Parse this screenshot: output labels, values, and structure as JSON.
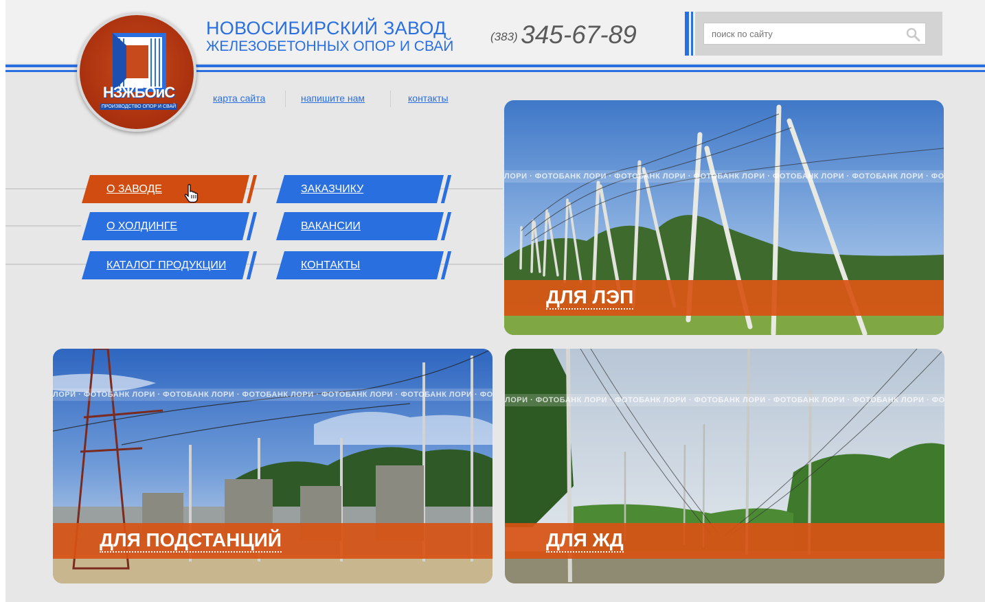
{
  "header": {
    "company_title": "НОВОСИБИРСКИЙ ЗАВОД",
    "company_subtitle": "ЖЕЛЕЗОБЕТОННЫХ ОПОР И СВАЙ",
    "logo_text": "НЗЖБОиС",
    "logo_subtext": "ПРОИЗВОДСТВО ОПОР И СВАЙ",
    "phone_code": "(383)",
    "phone_number": "345-67-89",
    "search_placeholder": "поиск по сайту"
  },
  "top_links": [
    {
      "label": "карта сайта"
    },
    {
      "label": "напишите нам"
    },
    {
      "label": "контакты"
    }
  ],
  "nav": {
    "about_factory": "О ЗАВОДЕ",
    "customers": "ЗАКАЗЧИКУ",
    "holding": "О ХОЛДИНГЕ",
    "vacancies": "ВАКАНСИИ",
    "catalog": "КАТАЛОГ ПРОДУКЦИИ",
    "contacts": "КОНТАКТЫ",
    "active": "О ЗАВОДЕ"
  },
  "tiles": [
    {
      "label": "ДЛЯ ЛЭП",
      "watermark": "ЛОРИ · ФОТОБАНК ЛОРИ · ФОТОБАНК ЛОРИ · ФОТОБАНК ЛОРИ · ФОТОБАНК ЛОРИ · ФОТОБАНК ЛОРИ · ФОТОБАНК ЛОРИ"
    },
    {
      "label": "ДЛЯ ПОДСТАНЦИЙ",
      "watermark": "ЛОРИ · ФОТОБАНК ЛОРИ · ФОТОБАНК ЛОРИ · ФОТОБАНК ЛОРИ · ФОТОБАНК ЛОРИ · ФОТОБАНК ЛОРИ · ФОТОБАНК"
    },
    {
      "label": "ДЛЯ ЖД",
      "watermark": "ЛОРИ · ФОТОБАНК ЛОРИ · ФОТОБАНК ЛОРИ · ФОТОБАНК ЛОРИ · ФОТОБАНК ЛОРИ · ФОТОБАНК ЛОРИ · ФОТОБАНК ЛОРИ"
    }
  ],
  "colors": {
    "brand_blue": "#2a6fe0",
    "brand_orange": "#d14c10",
    "background": "#e7e7e7"
  },
  "icons": {
    "search": "search-icon",
    "cursor": "hand-pointer-icon"
  }
}
